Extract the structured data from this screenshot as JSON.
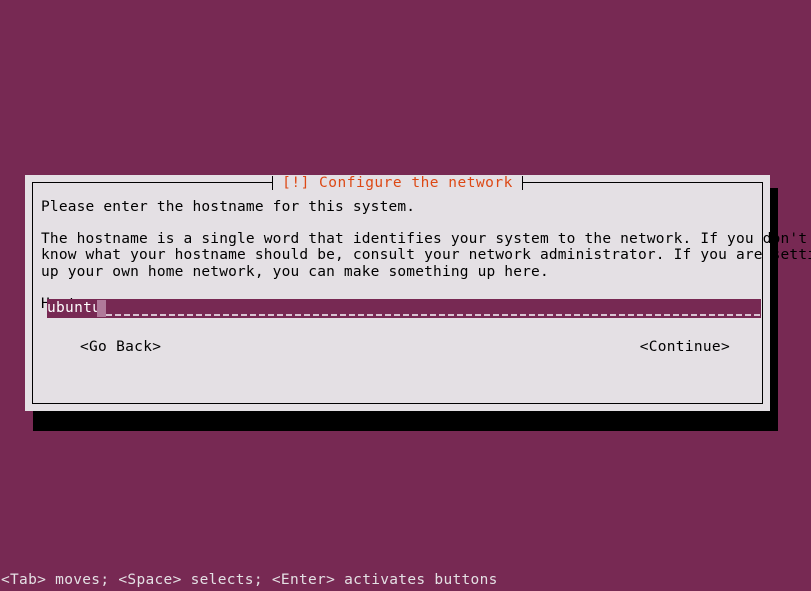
{
  "screen": {
    "background_color": "#772953",
    "status_hint": "<Tab> moves; <Space> selects; <Enter> activates buttons"
  },
  "dialog": {
    "title": "[!] Configure the network",
    "title_color": "#dd4814",
    "background_color": "#e4e0e4",
    "intro": "Please enter the hostname for this system.",
    "description_lines": [
      "The hostname is a single word that identifies your system to the network. If you don't",
      "know what your hostname should be, consult your network administrator. If you are setting",
      "up your own home network, you can make something up here."
    ],
    "field": {
      "label": "Hostname:",
      "value": "ubuntu",
      "field_background": "#772953",
      "field_text_color": "#ffffff"
    },
    "buttons": {
      "back": "<Go Back>",
      "continue": "<Continue>"
    }
  }
}
